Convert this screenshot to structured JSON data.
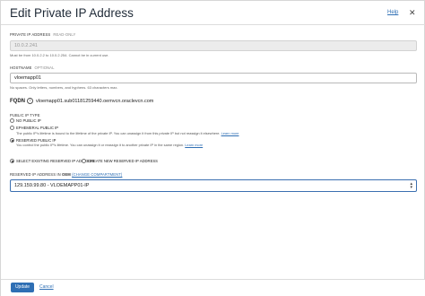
{
  "dialog": {
    "title": "Edit Private IP Address",
    "help_label": "Help",
    "close_glyph": "✕"
  },
  "private_ip": {
    "label": "PRIVATE IP ADDRESS",
    "tag": "READ-ONLY",
    "value": "10.0.2.241",
    "help": "Must be from 10.0.2.2 to 10.0.2.254. Cannot be in current use."
  },
  "hostname": {
    "label": "HOSTNAME",
    "tag": "OPTIONAL",
    "value": "vloemapp01",
    "help": "No spaces. Only letters, numbers, and hyphens. 63 characters max."
  },
  "fqdn": {
    "label": "FQDN",
    "info_glyph": "i",
    "value": "vloemapp01.sub01181259440.oemvcn.oraclevcn.com"
  },
  "public_ip_type": {
    "label": "PUBLIC IP TYPE",
    "options": [
      {
        "label": "NO PUBLIC IP",
        "desc": "",
        "link": "",
        "selected": false
      },
      {
        "label": "EPHEMERAL PUBLIC IP",
        "desc": "The public IP's lifetime is bound to the lifetime of the private IP. You can unassign it from this private IP but not reassign it elsewhere.",
        "link": "Learn more",
        "selected": false
      },
      {
        "label": "RESERVED PUBLIC IP",
        "desc": "You control the public IP's lifetime. You can unassign it or reassign it to another private IP in the same region.",
        "link": "Learn more",
        "selected": true
      }
    ]
  },
  "reserved_source": {
    "options": [
      {
        "label": "SELECT EXISTING RESERVED IP ADDRESS",
        "selected": true
      },
      {
        "label": "CREATE NEW RESERVED IP ADDRESS",
        "selected": false
      }
    ]
  },
  "reserved_ip": {
    "label": "RESERVED IP ADDRESS IN",
    "compartment": "OEM",
    "change_link": "(CHANGE COMPARTMENT)",
    "selected_value": "129.159.99.80 - VLOEMAPP01-IP"
  },
  "footer": {
    "update_label": "Update",
    "cancel_label": "Cancel"
  },
  "colors": {
    "accent": "#2f6fb4",
    "readonly_bg": "#ececec"
  }
}
